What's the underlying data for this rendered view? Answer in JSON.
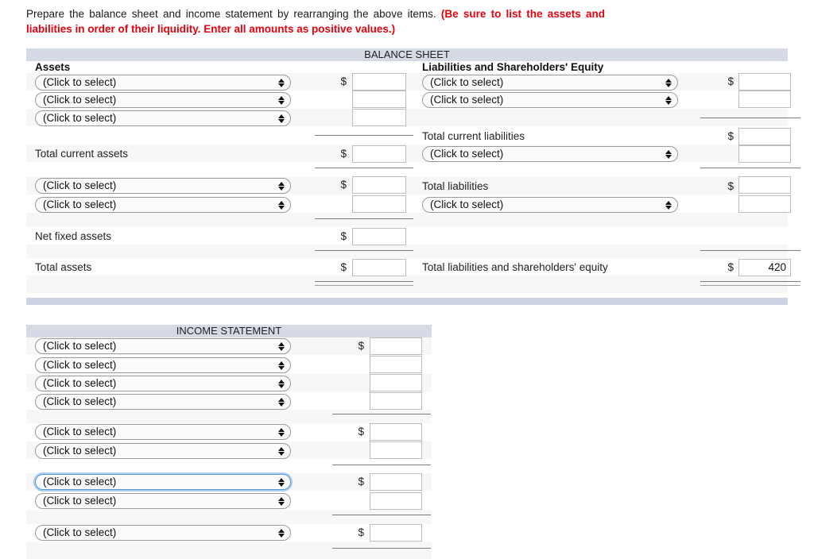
{
  "instruction": {
    "text_plain": "Prepare the balance sheet and income statement by rearranging the above items. ",
    "text_highlight": "(Be sure to list the assets and liabilities in order of their liquidity. Enter all amounts as positive values.)",
    "highlight_color": "#e8000d"
  },
  "select_placeholder": "(Click to select)",
  "currency_symbol": "$",
  "balance_sheet": {
    "title": "BALANCE SHEET",
    "assets_header": "Assets",
    "liabilities_header": "Liabilities and Shareholders' Equity",
    "assets_rows": [
      {
        "kind": "select",
        "label": "(Click to select)",
        "dollar": "$",
        "value": ""
      },
      {
        "kind": "select",
        "label": "(Click to select)",
        "dollar": "",
        "value": ""
      },
      {
        "kind": "select",
        "label": "(Click to select)",
        "dollar": "",
        "value": ""
      },
      {
        "kind": "total",
        "label": "Total current assets",
        "dollar": "$",
        "value": ""
      },
      {
        "kind": "select",
        "label": "(Click to select)",
        "dollar": "$",
        "value": ""
      },
      {
        "kind": "select",
        "label": "(Click to select)",
        "dollar": "",
        "value": ""
      },
      {
        "kind": "total",
        "label": "Net fixed assets",
        "dollar": "$",
        "value": ""
      },
      {
        "kind": "total",
        "label": "Total assets",
        "dollar": "$",
        "value": ""
      }
    ],
    "liabilities_rows": [
      {
        "kind": "select",
        "label": "(Click to select)",
        "dollar": "$",
        "value": ""
      },
      {
        "kind": "select",
        "label": "(Click to select)",
        "dollar": "",
        "value": ""
      },
      {
        "kind": "total",
        "label": "Total current liabilities",
        "dollar": "$",
        "value": ""
      },
      {
        "kind": "select",
        "label": "(Click to select)",
        "dollar": "",
        "value": ""
      },
      {
        "kind": "total",
        "label": "Total liabilities",
        "dollar": "$",
        "value": ""
      },
      {
        "kind": "select",
        "label": "(Click to select)",
        "dollar": "",
        "value": ""
      },
      {
        "kind": "total",
        "label": "Total liabilities and shareholders' equity",
        "dollar": "$",
        "value": "420"
      }
    ]
  },
  "income_statement": {
    "title": "INCOME STATEMENT",
    "rows": [
      {
        "label": "(Click to select)",
        "dollar": "$",
        "value": "",
        "focused": false
      },
      {
        "label": "(Click to select)",
        "dollar": "",
        "value": "",
        "focused": false
      },
      {
        "label": "(Click to select)",
        "dollar": "",
        "value": "",
        "focused": false
      },
      {
        "label": "(Click to select)",
        "dollar": "",
        "value": "",
        "focused": false
      },
      {
        "label": "(Click to select)",
        "dollar": "$",
        "value": "",
        "focused": false
      },
      {
        "label": "(Click to select)",
        "dollar": "",
        "value": "",
        "focused": false
      },
      {
        "label": "(Click to select)",
        "dollar": "$",
        "value": "",
        "focused": true
      },
      {
        "label": "(Click to select)",
        "dollar": "",
        "value": "",
        "focused": false
      },
      {
        "label": "(Click to select)",
        "dollar": "$",
        "value": "",
        "focused": false
      }
    ]
  }
}
